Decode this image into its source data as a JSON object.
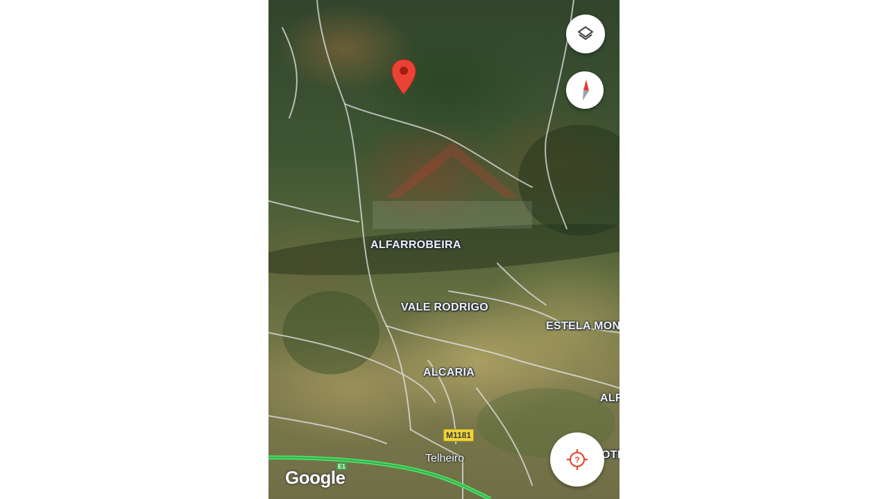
{
  "map": {
    "type": "satellite",
    "places": {
      "alfarrobeira": "ALFARROBEIRA",
      "vale_rodrigo": "VALE RODRIGO",
      "estela": "ESTELA MON",
      "alcaria": "ALCARIA",
      "alf_partial": "ALF",
      "telheiro": "Telheiro",
      "otl_partial": "OTL"
    },
    "road_shields": {
      "m1181": "M1181",
      "e1": "E1"
    },
    "attribution": "Google"
  },
  "controls": {
    "layers_icon": "layers-icon",
    "compass_icon": "compass-icon",
    "location_icon": "location-unknown-icon"
  },
  "colors": {
    "pin": "#ea4335",
    "highway": "#4cd964",
    "location_accent": "#e8472b"
  }
}
